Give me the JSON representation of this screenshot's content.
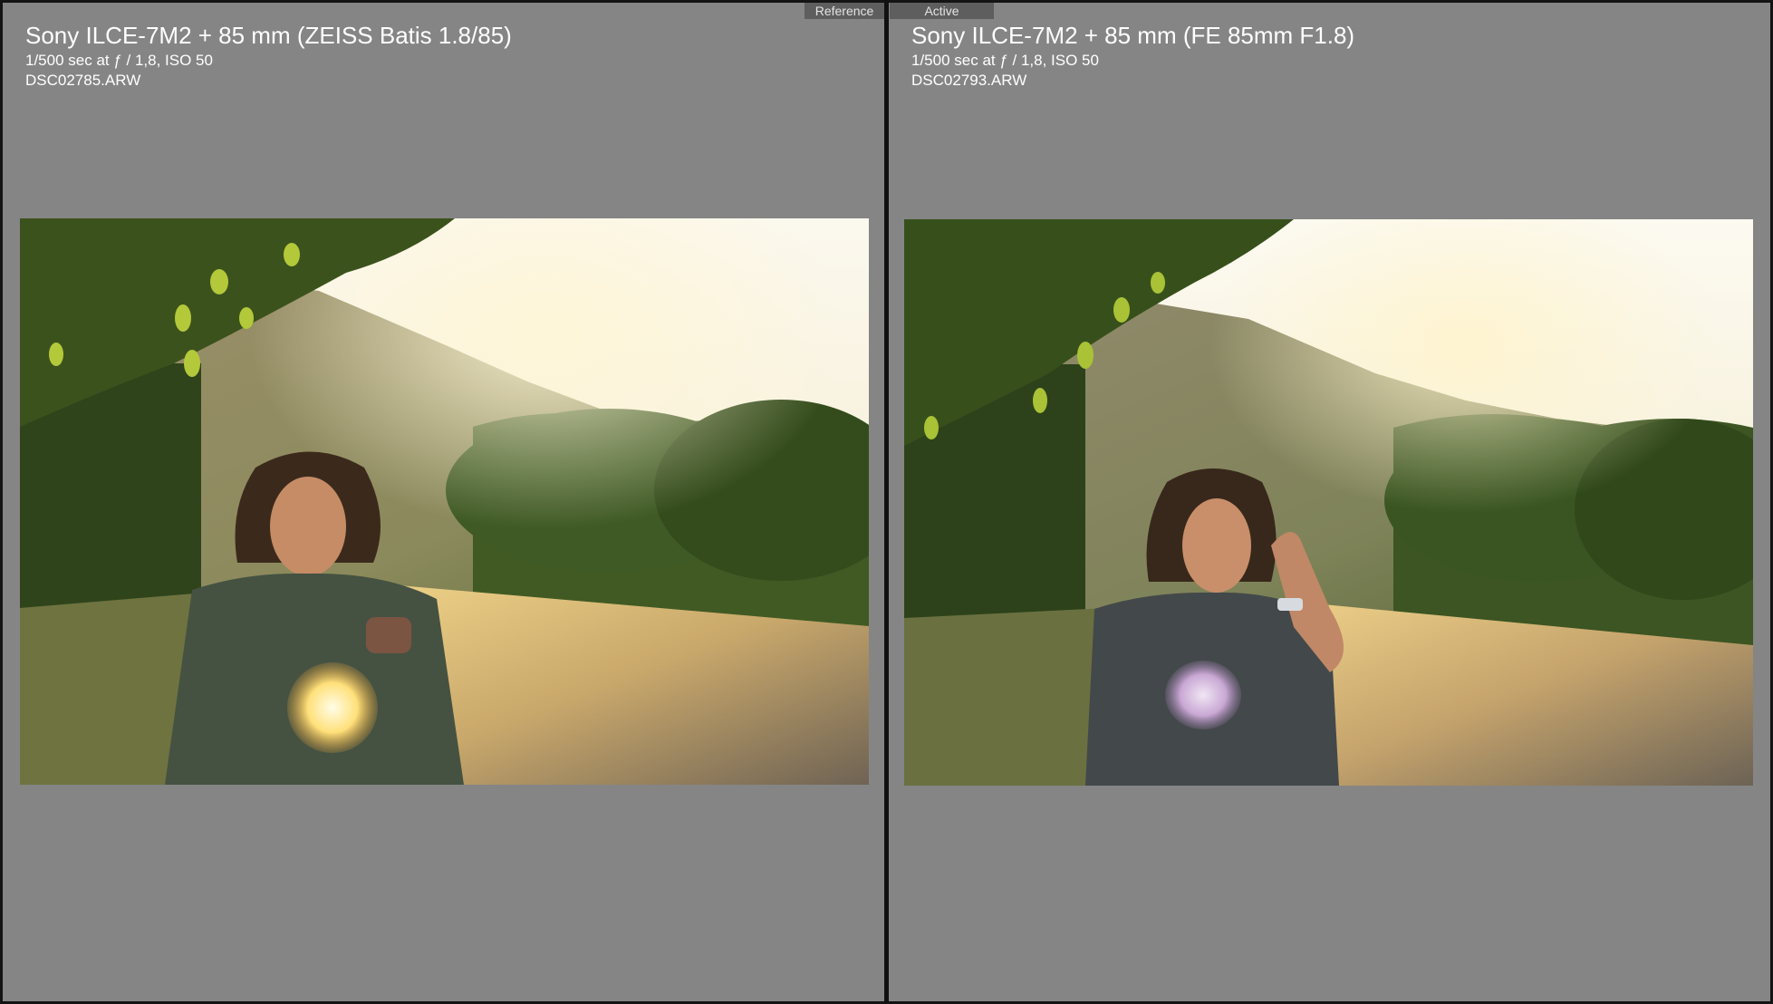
{
  "reference_panel": {
    "badge": "Reference",
    "title": "Sony ILCE-7M2 + 85 mm (ZEISS Batis 1.8/85)",
    "exposure": "1/500 sec at ƒ / 1,8, ISO 50",
    "filename": "DSC02785.ARW",
    "photo_name": "photo-reference"
  },
  "active_panel": {
    "badge": "Active",
    "title": "Sony ILCE-7M2 + 85 mm (FE 85mm F1.8)",
    "exposure": "1/500 sec at ƒ / 1,8, ISO 50",
    "filename": "DSC02793.ARW",
    "photo_name": "photo-active"
  },
  "colors": {
    "background": "#858585",
    "divider": "#111111",
    "badge": "#5e5e5e",
    "text": "#ffffff"
  }
}
